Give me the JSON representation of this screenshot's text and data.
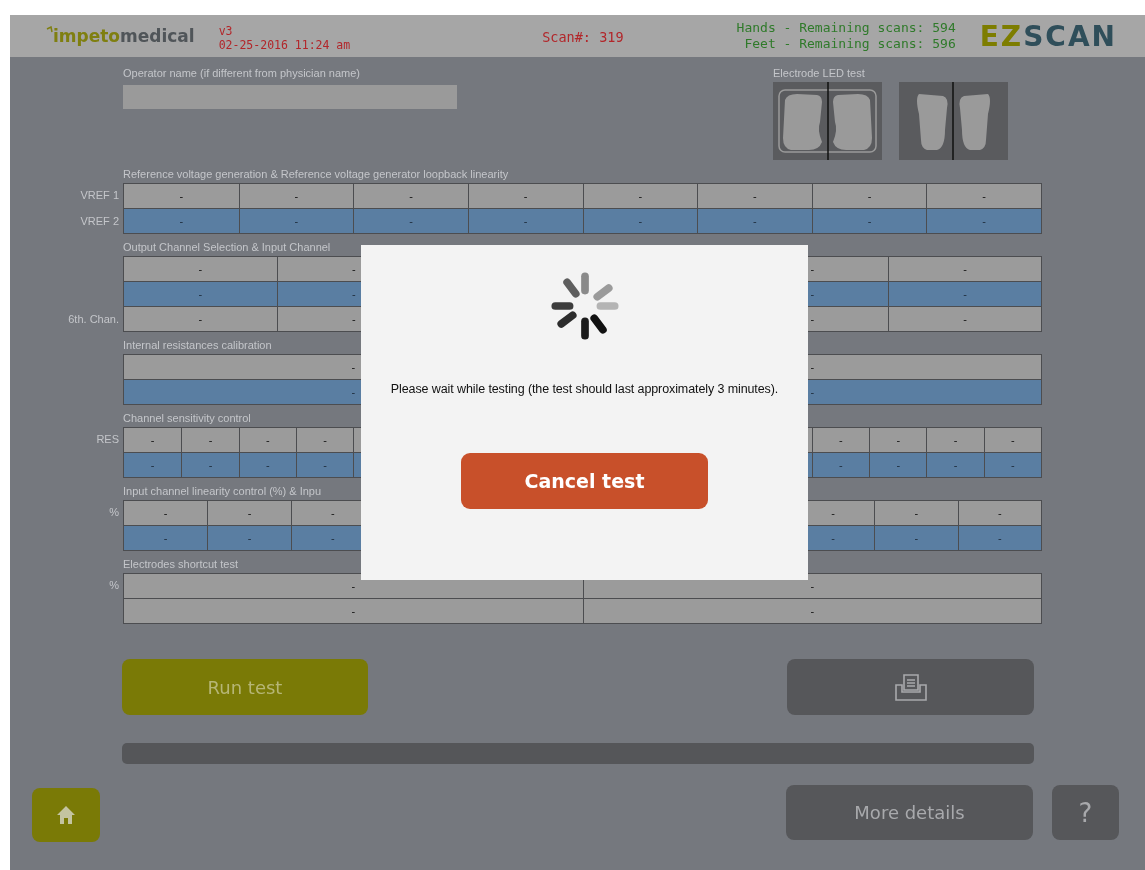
{
  "header": {
    "logo_prefix": "impeto",
    "logo_suffix": "medical",
    "version": "v3",
    "datetime": "02-25-2016 11:24 am",
    "scan": "Scan#: 319",
    "remaining": [
      "Hands - Remaining scans: 594",
      "Feet - Remaining scans: 596"
    ],
    "product_prefix": "EZ",
    "product_suffix": "SCAN"
  },
  "operator": {
    "label": "Operator name (if different from physician name)"
  },
  "led_test": {
    "label": "Electrode LED test"
  },
  "sections": [
    {
      "title": "Reference voltage generation & Reference voltage generator loopback linearity",
      "rows": [
        {
          "label": "VREF 1",
          "kind": "grey",
          "cells": [
            "-",
            "-",
            "-",
            "-",
            "-",
            "-",
            "-",
            "-"
          ]
        },
        {
          "label": "VREF 2",
          "kind": "blue",
          "cells": [
            "-",
            "-",
            "-",
            "-",
            "-",
            "-",
            "-",
            "-"
          ]
        }
      ]
    },
    {
      "title": "Output Channel Selection & Input Channel",
      "rows": [
        {
          "kind": "grey",
          "cells": [
            "-",
            "-",
            null,
            null,
            "-",
            "-"
          ]
        },
        {
          "kind": "blue",
          "cells": [
            "-",
            "-",
            null,
            null,
            "-",
            "-"
          ]
        },
        {
          "label": "6th. Chan.",
          "kind": "grey",
          "cells": [
            "-",
            "-",
            null,
            null,
            "-",
            "-"
          ]
        }
      ]
    },
    {
      "title": "Internal resistances calibration",
      "rows": [
        {
          "kind": "grey",
          "cells": [
            "-",
            "-"
          ]
        },
        {
          "kind": "blue",
          "cells": [
            "-",
            "-"
          ]
        }
      ]
    },
    {
      "title": "Channel sensitivity control",
      "rows": [
        {
          "label": "RES",
          "kind": "grey",
          "cells": [
            "-",
            "-",
            "-",
            "-",
            null,
            null,
            null,
            null,
            null,
            null,
            null,
            null,
            "-",
            "-",
            "-",
            "-"
          ]
        },
        {
          "kind": "blue",
          "cells": [
            "-",
            "-",
            "-",
            "-",
            null,
            null,
            null,
            null,
            null,
            null,
            null,
            null,
            "-",
            "-",
            "-",
            "-"
          ]
        }
      ]
    },
    {
      "title": "Input channel linearity control (%) & Inpu",
      "rows": [
        {
          "label": "%",
          "kind": "grey",
          "cells": [
            "-",
            "-",
            "-",
            null,
            null,
            null,
            null,
            null,
            "-",
            "-",
            "-"
          ]
        },
        {
          "kind": "blue",
          "cells": [
            "-",
            "-",
            "-",
            null,
            null,
            null,
            null,
            null,
            "-",
            "-",
            "-"
          ]
        }
      ]
    },
    {
      "title": "Electrodes shortcut test",
      "rows": [
        {
          "label": "%",
          "kind": "grey",
          "cells": [
            "-",
            "-"
          ]
        },
        {
          "kind": "grey",
          "cells": [
            "-",
            "-"
          ]
        }
      ]
    }
  ],
  "run_button": "Run test",
  "progress": {
    "level": 0
  },
  "more_details_button": "More details",
  "help_button": "?",
  "modal": {
    "message": "Please wait while testing (the test should last approximately 3 minutes).",
    "cancel_button": "Cancel test"
  }
}
